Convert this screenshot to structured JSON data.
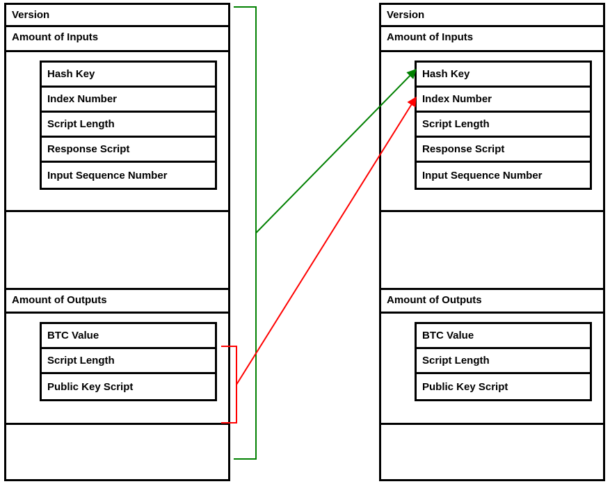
{
  "diagram": {
    "green": "#008000",
    "red": "#ff0000"
  },
  "left": {
    "version": "Version",
    "amount_inputs": "Amount of Inputs",
    "input": {
      "hash_key": "Hash Key",
      "index_number": "Index Number",
      "script_length": "Script Length",
      "response_script": "Response Script",
      "input_sequence_number": "Input Sequence Number"
    },
    "amount_outputs": "Amount of Outputs",
    "output": {
      "btc_value": "BTC Value",
      "script_length": "Script Length",
      "public_key_script": "Public Key Script"
    }
  },
  "right": {
    "version": "Version",
    "amount_inputs": "Amount of Inputs",
    "input": {
      "hash_key": "Hash Key",
      "index_number": "Index Number",
      "script_length": "Script Length",
      "response_script": "Response Script",
      "input_sequence_number": "Input Sequence Number"
    },
    "amount_outputs": "Amount of Outputs",
    "output": {
      "btc_value": "BTC Value",
      "script_length": "Script Length",
      "public_key_script": "Public Key Script"
    }
  }
}
